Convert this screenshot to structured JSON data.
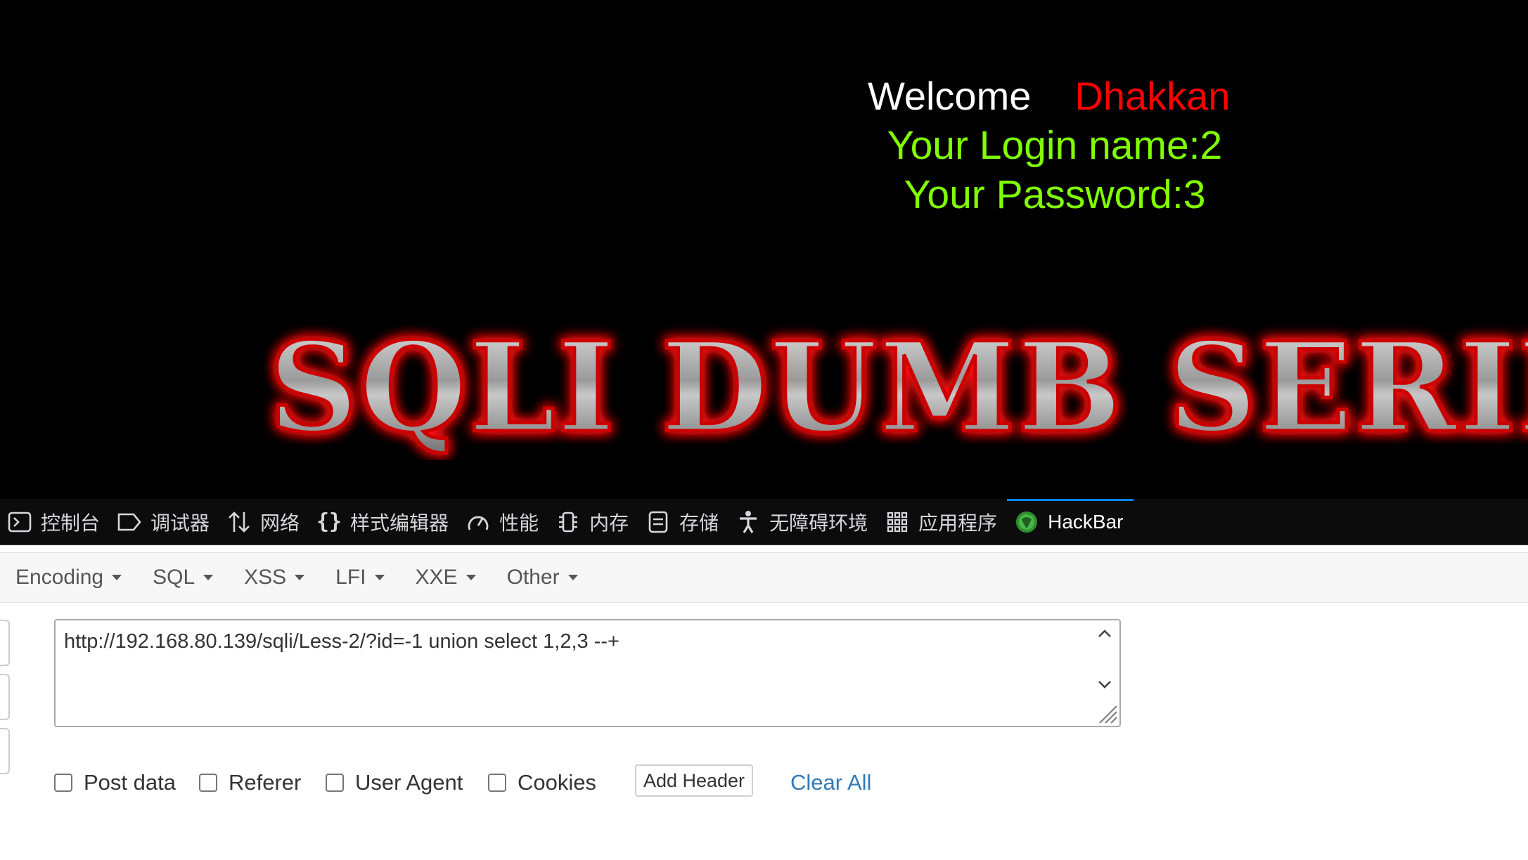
{
  "page": {
    "welcome_label": "Welcome",
    "welcome_name": "Dhakkan",
    "login_line": "Your Login name:2",
    "password_line": "Your Password:3",
    "banner_text": "SQLI DUMB SERIE"
  },
  "devtools": {
    "tabs": [
      {
        "label": "控制台",
        "icon": "console-icon"
      },
      {
        "label": "调试器",
        "icon": "debugger-icon"
      },
      {
        "label": "网络",
        "icon": "network-icon"
      },
      {
        "label": "样式编辑器",
        "icon": "style-editor-icon"
      },
      {
        "label": "性能",
        "icon": "performance-icon"
      },
      {
        "label": "内存",
        "icon": "memory-icon"
      },
      {
        "label": "存储",
        "icon": "storage-icon"
      },
      {
        "label": "无障碍环境",
        "icon": "accessibility-icon"
      },
      {
        "label": "应用程序",
        "icon": "application-icon"
      },
      {
        "label": "HackBar",
        "icon": "hackbar-icon",
        "active": true
      }
    ]
  },
  "hackbar": {
    "menus": [
      "Encoding",
      "SQL",
      "XSS",
      "LFI",
      "XXE",
      "Other"
    ],
    "url_value": "http://192.168.80.139/sqli/Less-2/?id=-1 union select 1,2,3 --+",
    "options": {
      "post_data": "Post data",
      "referer": "Referer",
      "user_agent": "User Agent",
      "cookies": "Cookies"
    },
    "add_header": "Add Header",
    "clear_all": "Clear All"
  },
  "colors": {
    "page_bg": "#000000",
    "welcome_text": "#ffffff",
    "name_red": "#ff0000",
    "credentials_green": "#80ff00",
    "devtools_bg": "#0c0c0d",
    "active_tab_indicator": "#0a84ff",
    "link_blue": "#337ab7"
  }
}
